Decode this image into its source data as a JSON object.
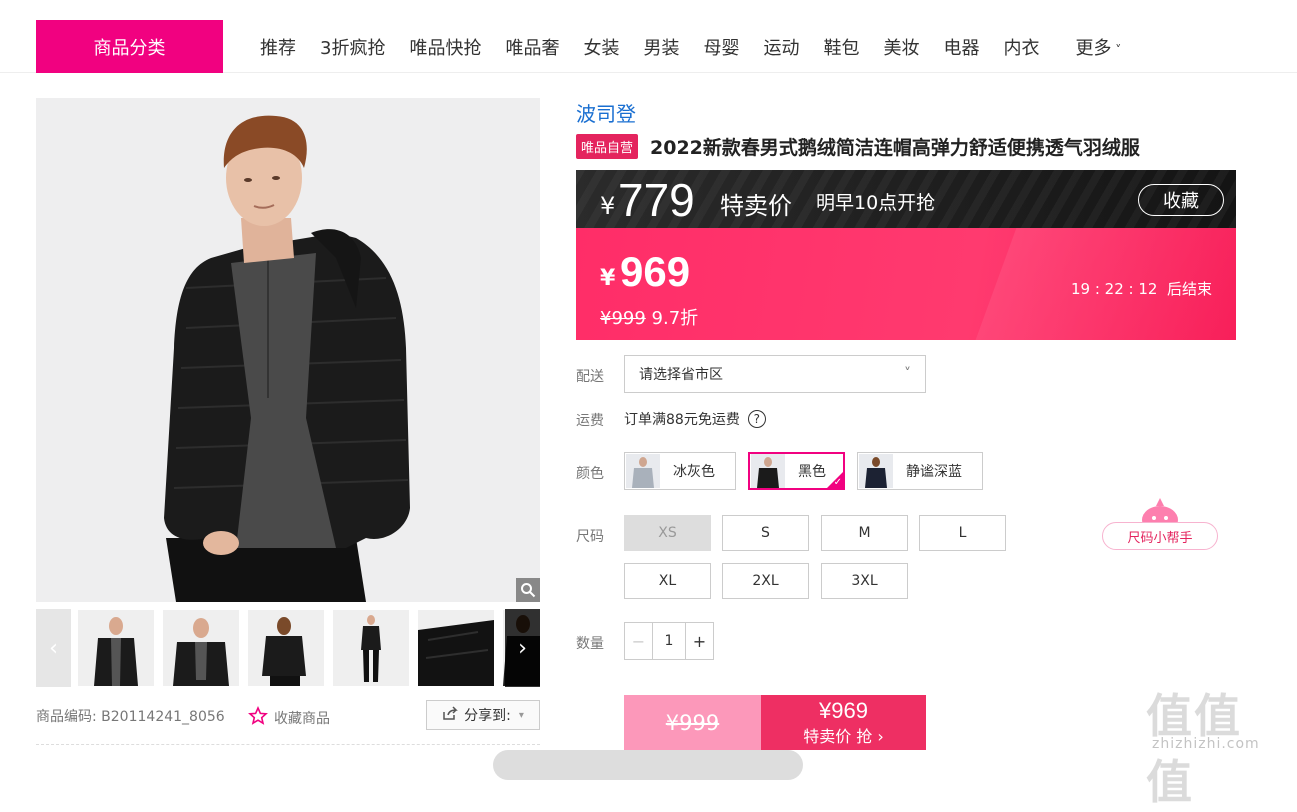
{
  "navbar": {
    "category_label": "商品分类",
    "items": [
      "推荐",
      "3折疯抢",
      "唯品快抢",
      "唯品奢",
      "女装",
      "男装",
      "母婴",
      "运动",
      "鞋包",
      "美妆",
      "电器",
      "内衣"
    ],
    "more_label": "更多"
  },
  "gallery": {
    "thumb_count": 6,
    "product_code_label": "商品编码:",
    "product_code": "B20114241_8056",
    "favorite_label": "收藏商品",
    "share_label": "分享到:"
  },
  "product": {
    "brand": "波司登",
    "self_operated_tag": "唯品自营",
    "title": "2022新款春男式鹅绒简洁连帽高弹力舒适便携透气羽绒服"
  },
  "special": {
    "currency": "¥",
    "price": "779",
    "label": "特卖价",
    "start_time": "明早10点开抢",
    "favorite_label": "收藏"
  },
  "current": {
    "currency": "¥",
    "price": "969",
    "original_price": "¥999",
    "discount": "9.7折",
    "countdown": "19 : 22 : 12",
    "countdown_suffix": "后结束"
  },
  "delivery": {
    "label": "配送",
    "placeholder": "请选择省市区"
  },
  "shipping": {
    "label": "运费",
    "text": "订单满88元免运费"
  },
  "colors": {
    "label": "颜色",
    "options": [
      {
        "name": "冰灰色",
        "selected": false
      },
      {
        "name": "黑色",
        "selected": true
      },
      {
        "name": "静谧深蓝",
        "selected": false
      }
    ]
  },
  "sizes": {
    "label": "尺码",
    "options": [
      {
        "name": "XS",
        "available": false
      },
      {
        "name": "S",
        "available": true
      },
      {
        "name": "M",
        "available": true
      },
      {
        "name": "L",
        "available": true
      },
      {
        "name": "XL",
        "available": true
      },
      {
        "name": "2XL",
        "available": true
      },
      {
        "name": "3XL",
        "available": true
      }
    ],
    "helper_label": "尺码小帮手"
  },
  "quantity": {
    "label": "数量",
    "value": "1",
    "minus": "−",
    "plus": "+"
  },
  "buy": {
    "original_price": "¥999",
    "special_price": "¥969",
    "action_label": "特卖价 抢"
  },
  "watermark": {
    "big": "值值值",
    "small": "zhizhizhi.com"
  },
  "colors_theme": {
    "accent": "#f10180",
    "price_pink": "#ff2d68",
    "buy_pink": "#ee2f63",
    "brand_link": "#1a6fd1"
  }
}
